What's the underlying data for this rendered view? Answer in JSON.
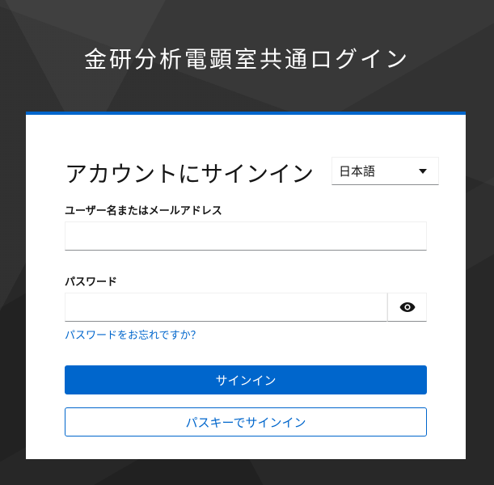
{
  "page": {
    "title": "金研分析電顕室共通ログイン"
  },
  "login": {
    "heading": "アカウントにサインイン",
    "language": {
      "selected": "日本語"
    },
    "username": {
      "label": "ユーザー名またはメールアドレス",
      "value": ""
    },
    "password": {
      "label": "パスワード",
      "value": "",
      "reveal_icon": "eye-icon"
    },
    "forgot_password_link": "パスワードをお忘れですか？",
    "sign_in_button": "サインイン",
    "passkey_button": "パスキーでサインイン"
  },
  "colors": {
    "accent": "#0066cc",
    "background": "#2a2a2a",
    "card": "#ffffff"
  }
}
